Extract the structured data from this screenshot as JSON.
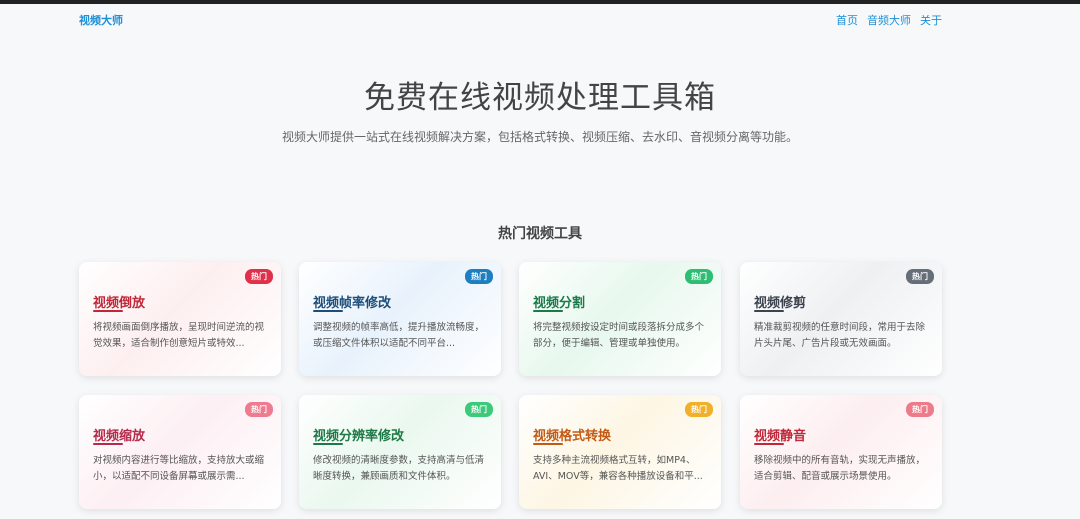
{
  "nav": {
    "brand": "视频大师",
    "links": [
      "首页",
      "音频大师",
      "关于"
    ]
  },
  "hero": {
    "title": "免费在线视频处理工具箱",
    "subtitle": "视频大师提供一站式在线视频解决方案，包括格式转换、视频压缩、去水印、音视频分离等功能。"
  },
  "section": {
    "title": "热门视频工具"
  },
  "cards": [
    {
      "title": "视频倒放",
      "badge": "热门",
      "desc": "将视频画面倒序播放，呈现时间逆流的视觉效果，适合制作创意短片或特效...",
      "color": "#c0283a",
      "badge_color": "#e0314a",
      "tint": "#fdeff0"
    },
    {
      "title": "视频帧率修改",
      "badge": "热门",
      "desc": "调整视频的帧率高低，提升播放流畅度，或压缩文件体积以适配不同平台...",
      "color": "#1d4e7a",
      "badge_color": "#1d7fbf",
      "tint": "#e8f2fc"
    },
    {
      "title": "视频分割",
      "badge": "热门",
      "desc": "将完整视频按设定时间或段落拆分成多个部分，便于编辑、管理或单独使用。",
      "color": "#1b7a4a",
      "badge_color": "#2ebd72",
      "tint": "#e7f8ee"
    },
    {
      "title": "视频修剪",
      "badge": "热门",
      "desc": "精准裁剪视频的任意时间段，常用于去除片头片尾、广告片段或无效画面。",
      "color": "#3d4450",
      "badge_color": "#666e7a",
      "tint": "#eef0f2"
    },
    {
      "title": "视频缩放",
      "badge": "热门",
      "desc": "对视频内容进行等比缩放，支持放大或缩小，以适配不同设备屏幕或展示需...",
      "color": "#b5294a",
      "badge_color": "#ee7b90",
      "tint": "#fdeff3"
    },
    {
      "title": "视频分辨率修改",
      "badge": "热门",
      "desc": "修改视频的清晰度参数，支持高清与低清晰度转换，兼顾画质和文件体积。",
      "color": "#1d7a46",
      "badge_color": "#3cc97a",
      "tint": "#eaf8ef"
    },
    {
      "title": "视频格式转换",
      "badge": "热门",
      "desc": "支持多种主流视频格式互转，如MP4、AVI、MOV等，兼容各种播放设备和平...",
      "color": "#c25a15",
      "badge_color": "#f0b02a",
      "tint": "#fdf6e4"
    },
    {
      "title": "视频静音",
      "badge": "热门",
      "desc": "移除视频中的所有音轨，实现无声播放，适合剪辑、配音或展示场景使用。",
      "color": "#c0283a",
      "badge_color": "#ee7b8a",
      "tint": "#fdeef0"
    }
  ]
}
